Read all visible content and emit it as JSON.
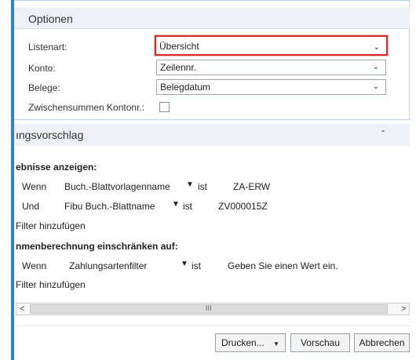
{
  "options": {
    "title": "Optionen",
    "fields": [
      {
        "label": "Listenart:",
        "value": "Übersicht"
      },
      {
        "label": "Konto:",
        "value": "Zeilennr."
      },
      {
        "label": "Belege:",
        "value": "Belegdatum"
      }
    ],
    "checkbox_label": "Zwischensummen Kontonr.:"
  },
  "section": {
    "title": "ıngsvorschlag",
    "filter1": {
      "heading": "ebnisse anzeigen:",
      "rows": [
        {
          "conj": "Wenn",
          "field": "Buch.-Blattvorlagenname",
          "op": "ist",
          "value": "ZA-ERW"
        },
        {
          "conj": "Und",
          "field": "Fibu Buch.-Blattname",
          "op": "ist",
          "value": "ZV000015Z"
        }
      ],
      "add_filter": "Filter hinzufügen"
    },
    "filter2": {
      "heading": "nmenberechnung einschränken auf:",
      "rows": [
        {
          "conj": "Wenn",
          "field": "Zahlungsartenfilter",
          "op": "ist",
          "value": "Geben Sie einen Wert ein."
        }
      ],
      "add_filter": "Filter hinzufügen"
    }
  },
  "scrollbar": {
    "left": "<",
    "right": ">",
    "thumb": "III"
  },
  "buttons": {
    "print": "Drucken...",
    "preview": "Vorschau",
    "cancel": "Abbrechen"
  },
  "icons": {
    "chevron": "chevron-down-icon",
    "collapse": "chevron-up-icon"
  }
}
